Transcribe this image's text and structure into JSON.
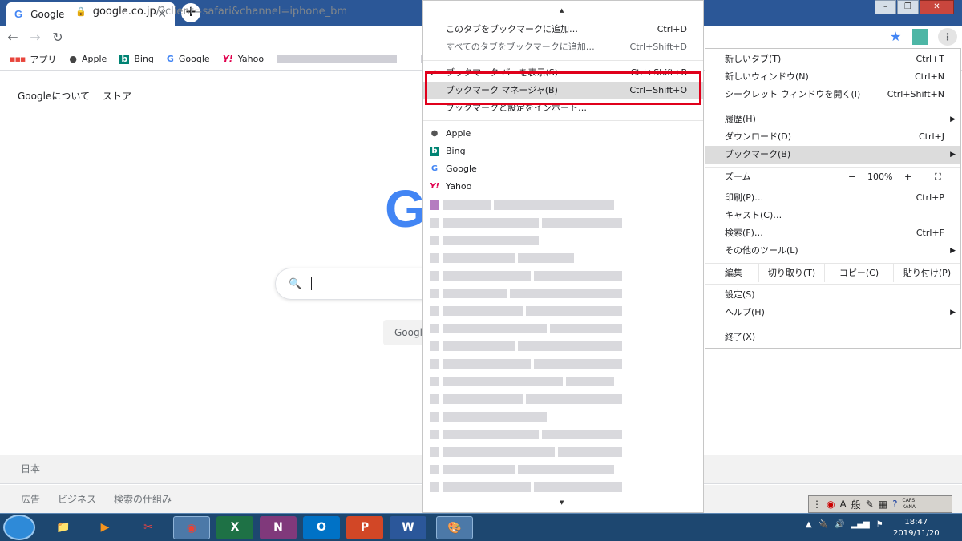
{
  "browser": {
    "tab_title": "Google",
    "tab_favicon": "G",
    "url_host": "google.co.jp",
    "url_path": "/?client=safari&channel=iphone_bm"
  },
  "bookmarks_bar": [
    {
      "label": "アプリ",
      "icon": "apps-grid-icon"
    },
    {
      "label": "Apple",
      "icon": "apple-icon"
    },
    {
      "label": "Bing",
      "icon": "bing-icon"
    },
    {
      "label": "Google",
      "icon": "google-icon"
    },
    {
      "label": "Yahoo",
      "icon": "yahoo-icon"
    }
  ],
  "page": {
    "top_links": [
      "Googleについて",
      "ストア"
    ],
    "logo_letter": "G",
    "button_label": "Googl",
    "footer_country": "日本",
    "footer_links": [
      "広告",
      "ビジネス",
      "検索の仕組み"
    ]
  },
  "bookmarks_menu": {
    "top_items": [
      {
        "label": "このタブをブックマークに追加…",
        "shortcut": "Ctrl+D",
        "dim": false
      },
      {
        "label": "すべてのタブをブックマークに追加…",
        "shortcut": "Ctrl+Shift+D",
        "dim": true
      }
    ],
    "show_bar": {
      "label": "ブックマーク バーを表示(S)",
      "shortcut": "Ctrl+Shift+B",
      "checked": true
    },
    "manager": {
      "label": "ブックマーク マネージャ(B)",
      "shortcut": "Ctrl+Shift+O",
      "highlighted": true
    },
    "import": {
      "label": "ブックマークと設定をインポート…"
    },
    "bookmarks": [
      {
        "label": "Apple",
        "icon": "apple-icon"
      },
      {
        "label": "Bing",
        "icon": "bing-icon"
      },
      {
        "label": "Google",
        "icon": "google-icon"
      },
      {
        "label": "Yahoo",
        "icon": "yahoo-icon"
      }
    ]
  },
  "chrome_menu": {
    "items": [
      {
        "label": "新しいタブ(T)",
        "shortcut": "Ctrl+T"
      },
      {
        "label": "新しいウィンドウ(N)",
        "shortcut": "Ctrl+N"
      },
      {
        "label": "シークレット ウィンドウを開く(I)",
        "shortcut": "Ctrl+Shift+N"
      },
      {
        "label": "履歴(H)",
        "shortcut": "",
        "submenu": true
      },
      {
        "label": "ダウンロード(D)",
        "shortcut": "Ctrl+J"
      },
      {
        "label": "ブックマーク(B)",
        "shortcut": "",
        "submenu": true,
        "highlighted": true
      },
      {
        "label": "印刷(P)…",
        "shortcut": "Ctrl+P"
      },
      {
        "label": "キャスト(C)…",
        "shortcut": ""
      },
      {
        "label": "検索(F)…",
        "shortcut": "Ctrl+F"
      },
      {
        "label": "その他のツール(L)",
        "shortcut": "",
        "submenu": true
      },
      {
        "label": "設定(S)",
        "shortcut": ""
      },
      {
        "label": "ヘルプ(H)",
        "shortcut": "",
        "submenu": true
      },
      {
        "label": "終了(X)",
        "shortcut": ""
      }
    ],
    "zoom": {
      "label": "ズーム",
      "minus": "−",
      "value": "100%",
      "plus": "+",
      "fullscreen": "⛶"
    },
    "edit": {
      "label": "編集",
      "cut": "切り取り(T)",
      "copy": "コピー(C)",
      "paste": "貼り付け(P)"
    }
  },
  "taskbar": {
    "apps": [
      {
        "name": "explorer",
        "glyph": "📁"
      },
      {
        "name": "media-player",
        "glyph": "▶"
      },
      {
        "name": "paint-tool",
        "glyph": "✂"
      },
      {
        "name": "chrome",
        "glyph": "◉",
        "active": true
      },
      {
        "name": "excel",
        "glyph": "X"
      },
      {
        "name": "onenote",
        "glyph": "N"
      },
      {
        "name": "outlook",
        "glyph": "O"
      },
      {
        "name": "powerpoint",
        "glyph": "P"
      },
      {
        "name": "word",
        "glyph": "W"
      },
      {
        "name": "paint",
        "glyph": "🎨",
        "active": true
      }
    ],
    "ime_mode": "A",
    "ime_label": "般",
    "caps": "CAPS",
    "kana": "KANA",
    "time": "18:47",
    "date": "2019/11/20"
  },
  "colors": {
    "titlebar": "#2b5797",
    "highlight_box": "#e0001b",
    "google_blue": "#4285f4",
    "taskbar": "#1d4770"
  }
}
